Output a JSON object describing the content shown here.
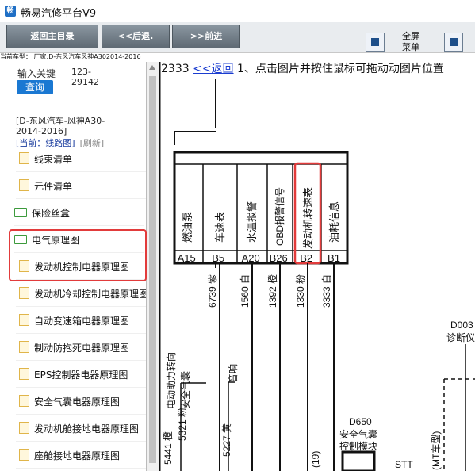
{
  "app": {
    "title": "畅易汽修平台V9"
  },
  "toolbar": {
    "home_label": "返回主目录",
    "back_label": "<<后退.",
    "forward_label": ">>前进",
    "fullscreen_label": "全屏",
    "menu_label": "菜单"
  },
  "model_info": "当前车型：  厂家:D-东风汽车风神A302014-2016",
  "search": {
    "label": "输入关键",
    "value_line1": "123-",
    "value_line2": "29142",
    "button": "查询"
  },
  "sidebar": {
    "model_line1": "[D-东风汽车-风神A30-",
    "model_line2": "2014-2016]",
    "current": "[当前：线路图]",
    "refresh": "[刷新]",
    "items": [
      {
        "label": "线束清单",
        "type": "file"
      },
      {
        "label": "元件清单",
        "type": "file"
      },
      {
        "label": "保险丝盒",
        "type": "folder"
      },
      {
        "label": "电气原理图",
        "type": "folder"
      },
      {
        "label": "发动机控制电器原理图",
        "type": "file"
      },
      {
        "label": "发动机冷却控制电器原理图",
        "type": "file"
      },
      {
        "label": "自动变速箱电器原理图",
        "type": "file"
      },
      {
        "label": "制动防抱死电器原理图",
        "type": "file"
      },
      {
        "label": "EPS控制器电器原理图",
        "type": "file"
      },
      {
        "label": "安全气囊电器原理图",
        "type": "file"
      },
      {
        "label": "发动机舱接地电器原理图",
        "type": "file"
      },
      {
        "label": "座舱接地电器原理图",
        "type": "file"
      }
    ]
  },
  "diagram": {
    "page_code": "2333",
    "back_link": "<<返回",
    "instruction": "1、点击图片并按住鼠标可拖动动图片位置",
    "gauges": [
      {
        "label": "燃油泵",
        "pin": "A15",
        "wire": "6739 紫"
      },
      {
        "label": "车速表",
        "pin": "B5",
        "wire": ""
      },
      {
        "label": "水温报警",
        "pin": "A20",
        "wire": "1560 白"
      },
      {
        "label": "OBD报警信号",
        "pin": "B26",
        "wire": "1392 橙"
      },
      {
        "label": "发动机转速表",
        "pin": "B2",
        "wire": "1330 粉"
      },
      {
        "label": "油耗信息",
        "pin": "B1",
        "wire": "3333 白"
      }
    ],
    "left_labels": {
      "eps": "电动助力转向",
      "airbag": "安全气囊",
      "speedo": "音响",
      "w5441": "5441 橙",
      "w5321": "5321 粉",
      "w5227": "5227 黄",
      "w19": "(19)"
    },
    "d650": "D650",
    "d650_desc1": "安全气囊",
    "d650_desc2": "控制模块",
    "d003": "D003",
    "d003_desc": "诊断仪",
    "stt": "STT",
    "right_vert": "(MT车型)"
  },
  "colors": {
    "highlight": "#e23b3b",
    "query_button": "#1a78d2",
    "link": "#1a3cd0"
  }
}
